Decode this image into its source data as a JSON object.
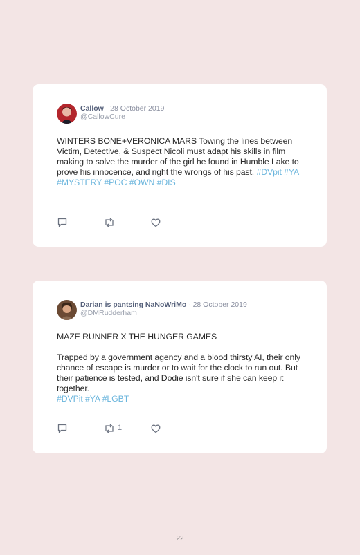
{
  "tweets": [
    {
      "display_name": "Callow",
      "date": "· 28 October 2019",
      "handle": "@CallowCure",
      "text": "WINTERS BONE+VERONICA MARS Towing the lines between Victim, Detective, & Suspect Nicoli must adapt his skills in film making to solve the murder of the girl he found in Humble Lake to prove his innocence, and right the wrongs of his past.",
      "hashtags": [
        "#DVpit",
        "#YA",
        "#MYSTERY",
        "#POC",
        "#OWN",
        "#DIS"
      ],
      "retweet_count": ""
    },
    {
      "display_name": "Darian is pantsing NaNoWriMo",
      "date": "· 28 October 2019",
      "handle": "@DMRudderham",
      "line_a": "MAZE RUNNER X THE HUNGER GAMES",
      "line_b": "Trapped by a government agency and a blood thirsty AI, their only chance of escape is murder or to wait for the clock to run out. But their patience is tested, and Dodie isn't sure if she can keep it together.",
      "hashtags": [
        "#DVPit",
        "#YA",
        "#LGBT"
      ],
      "retweet_count": "1"
    }
  ],
  "icons": [
    "reply-icon",
    "retweet-icon",
    "like-icon"
  ],
  "colors": {
    "page_bg": "#f3e5e5",
    "hashtag": "#6cb6dd",
    "name": "#55607a"
  },
  "page_number": "22"
}
